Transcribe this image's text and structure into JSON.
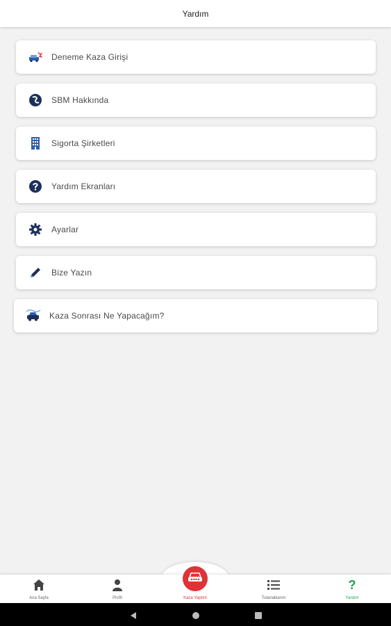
{
  "header": {
    "title": "Yardım"
  },
  "menu": [
    {
      "label": "Deneme Kaza Girişi",
      "icon": "car-crash-icon"
    },
    {
      "label": "SBM Hakkında",
      "icon": "sbm-logo-icon"
    },
    {
      "label": "Sigorta Şirketleri",
      "icon": "building-icon"
    },
    {
      "label": "Yardım Ekranları",
      "icon": "question-circle-icon"
    },
    {
      "label": "Ayarlar",
      "icon": "gear-icon"
    },
    {
      "label": "Bize Yazın",
      "icon": "pencil-icon"
    },
    {
      "label": "Kaza Sonrası Ne Yapacağım?",
      "icon": "car-accident-icon"
    }
  ],
  "bottom_nav": {
    "home": "Ana Sayfa",
    "profile": "Profil",
    "report": "Kaza Yaptım",
    "records": "Tutanaklarım",
    "help": "Yardım"
  },
  "colors": {
    "accent": "#1aa34a",
    "primary": "#e03238",
    "icon_navy": "#1c2f5c"
  }
}
